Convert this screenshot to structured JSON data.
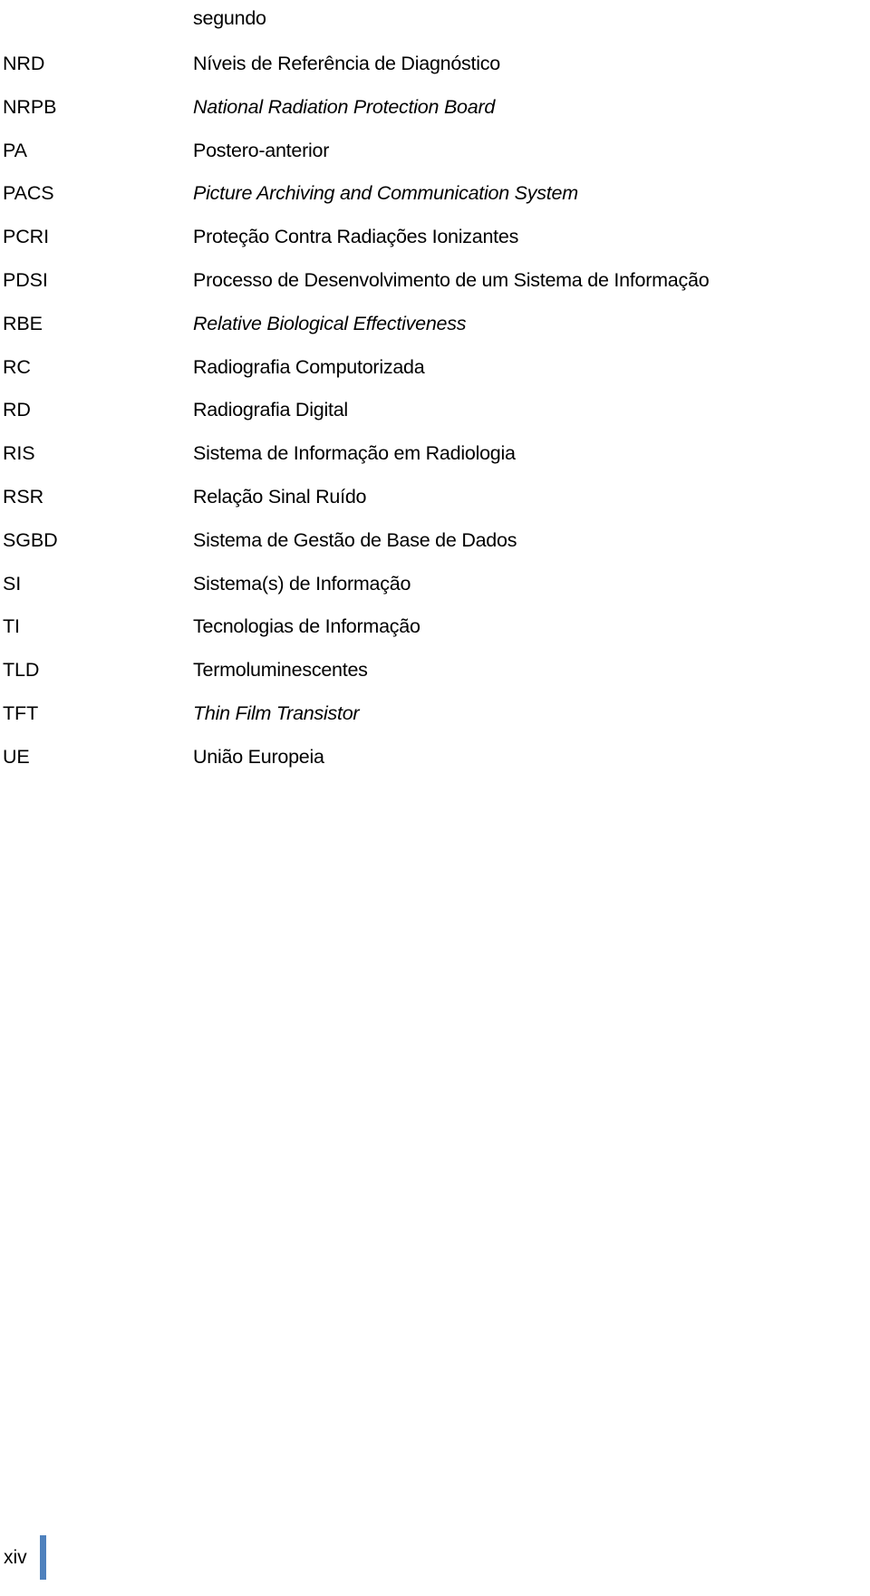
{
  "document": {
    "type": "glossary-page",
    "language": "pt-PT",
    "accent_color": "#4F81BD",
    "text_color": "#000000",
    "background_color": "#ffffff"
  },
  "glossary": {
    "rows": [
      {
        "abbr": "",
        "definition": "segundo",
        "italic": false
      },
      {
        "abbr": "NRD",
        "definition": "Níveis de Referência de Diagnóstico",
        "italic": false
      },
      {
        "abbr": "NRPB",
        "definition": "National Radiation Protection Board",
        "italic": true
      },
      {
        "abbr": "PA",
        "definition": "Postero-anterior",
        "italic": false
      },
      {
        "abbr": "PACS",
        "definition": "Picture Archiving and Communication System",
        "italic": true
      },
      {
        "abbr": "PCRI",
        "definition": "Proteção Contra Radiações Ionizantes",
        "italic": false
      },
      {
        "abbr": "PDSI",
        "definition": "Processo de Desenvolvimento de um Sistema de Informação",
        "italic": false
      },
      {
        "abbr": "RBE",
        "definition": "Relative Biological Effectiveness",
        "italic": true
      },
      {
        "abbr": "RC",
        "definition": "Radiografia Computorizada",
        "italic": false
      },
      {
        "abbr": "RD",
        "definition": "Radiografia Digital",
        "italic": false
      },
      {
        "abbr": "RIS",
        "definition": "Sistema de Informação em Radiologia",
        "italic": false
      },
      {
        "abbr": "RSR",
        "definition": "Relação Sinal Ruído",
        "italic": false
      },
      {
        "abbr": "SGBD",
        "definition": "Sistema de Gestão de Base de Dados",
        "italic": false
      },
      {
        "abbr": "SI",
        "definition": "Sistema(s) de Informação",
        "italic": false
      },
      {
        "abbr": "TI",
        "definition": "Tecnologias de Informação",
        "italic": false
      },
      {
        "abbr": "TLD",
        "definition": "Termoluminescentes",
        "italic": false
      },
      {
        "abbr": "TFT",
        "definition": "Thin Film Transistor",
        "italic": true
      },
      {
        "abbr": "UE",
        "definition": "União Europeia",
        "italic": false
      }
    ]
  },
  "footer": {
    "page_number": "xiv",
    "rule_color": "#4F81BD"
  }
}
